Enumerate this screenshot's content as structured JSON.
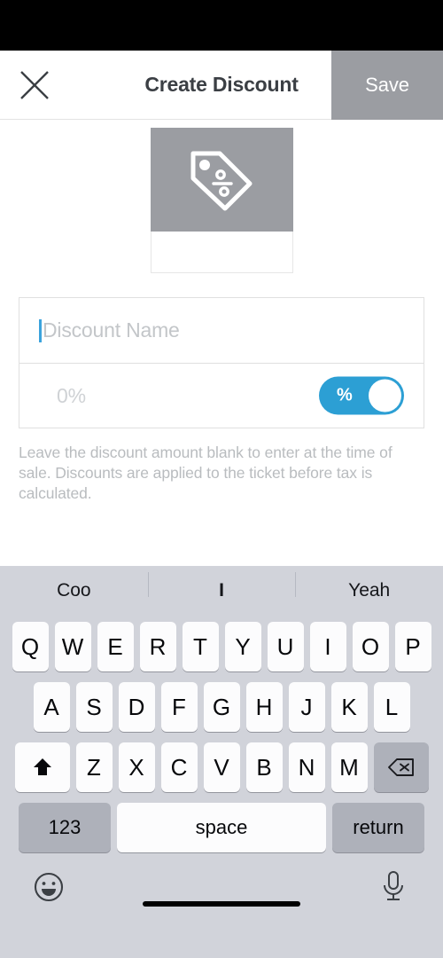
{
  "nav": {
    "close_icon": "close-x-icon",
    "title": "Create Discount",
    "save_label": "Save",
    "save_enabled": false,
    "save_bg": "#9b9da2"
  },
  "thumbnail": {
    "icon": "price-tag-percent-icon",
    "bg": "#9b9da2"
  },
  "form": {
    "name_field": {
      "value": "",
      "placeholder": "Discount Name",
      "caret_color": "#3ba3dd",
      "focused": true
    },
    "amount_field": {
      "value": "",
      "placeholder": "0%"
    },
    "type_toggle": {
      "label": "%",
      "state": "percent",
      "on_color": "#2c9fd4"
    }
  },
  "helper_text": "Leave the discount amount blank to enter at the time of sale. Discounts are applied to the ticket before tax is calculated.",
  "keyboard": {
    "suggestions": [
      "Coo",
      "I",
      "Yeah"
    ],
    "row1": [
      "Q",
      "W",
      "E",
      "R",
      "T",
      "Y",
      "U",
      "I",
      "O",
      "P"
    ],
    "row2": [
      "A",
      "S",
      "D",
      "F",
      "G",
      "H",
      "J",
      "K",
      "L"
    ],
    "row3": [
      "Z",
      "X",
      "C",
      "V",
      "B",
      "N",
      "M"
    ],
    "shift_icon": "shift-arrow-icon",
    "backspace_icon": "backspace-delete-icon",
    "numbers_label": "123",
    "space_label": "space",
    "return_label": "return",
    "emoji_icon": "emoji-smiley-icon",
    "mic_icon": "microphone-icon",
    "bg_color": "#d1d3da"
  }
}
